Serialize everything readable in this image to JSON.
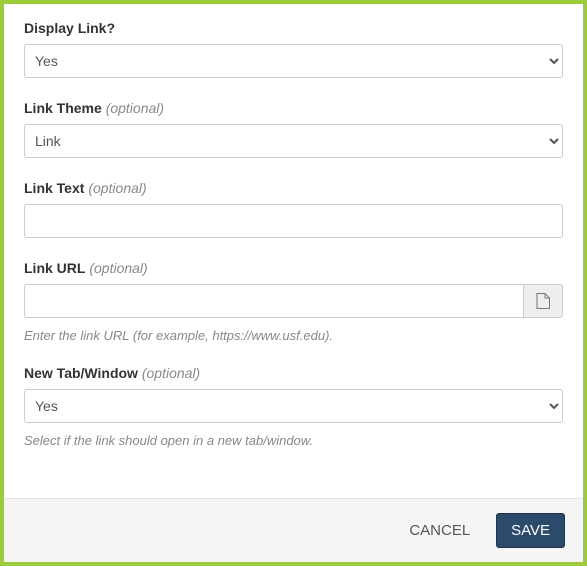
{
  "optional_suffix": "(optional)",
  "display_link": {
    "label": "Display Link?",
    "value": "Yes"
  },
  "link_theme": {
    "label": "Link Theme",
    "value": "Link"
  },
  "link_text": {
    "label": "Link Text",
    "value": ""
  },
  "link_url": {
    "label": "Link URL",
    "value": "",
    "help": "Enter the link URL (for example, https://www.usf.edu).",
    "addon_icon": "file-icon"
  },
  "new_tab": {
    "label": "New Tab/Window",
    "value": "Yes",
    "help": "Select if the link should open in a new tab/window."
  },
  "footer": {
    "cancel": "CANCEL",
    "save": "SAVE"
  }
}
